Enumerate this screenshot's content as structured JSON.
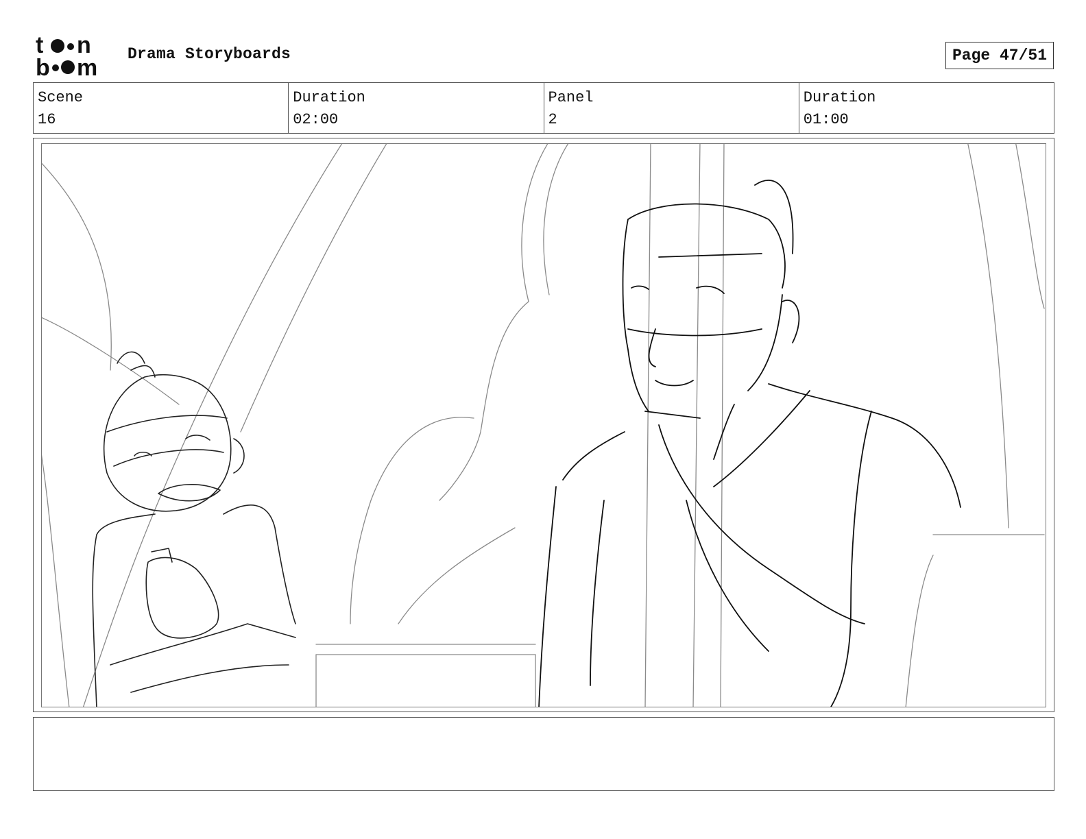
{
  "header": {
    "logo_top": "toon",
    "logo_bottom": "boom",
    "title": "Drama Storyboards",
    "page_label": "Page 47/51"
  },
  "info": {
    "scene_label": "Scene",
    "scene_value": "16",
    "scene_duration_label": "Duration",
    "scene_duration_value": "02:00",
    "panel_label": "Panel",
    "panel_value": "2",
    "panel_duration_label": "Duration",
    "panel_duration_value": "01:00"
  },
  "notes": {
    "text": ""
  }
}
